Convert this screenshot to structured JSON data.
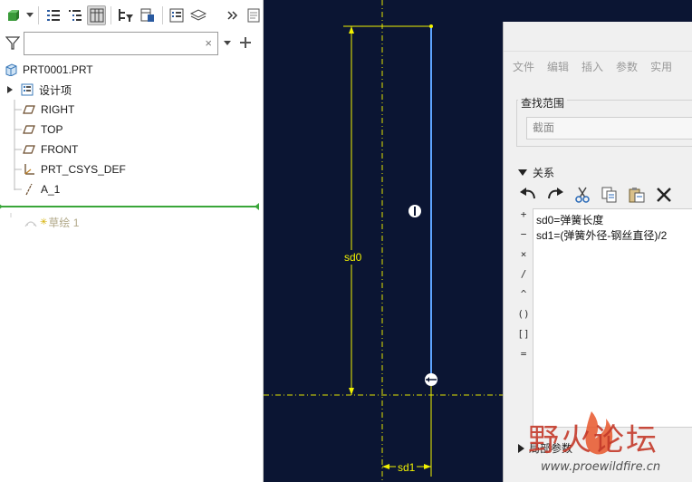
{
  "model_tree": {
    "root": "PRT0001.PRT",
    "items": [
      {
        "label": "设计项",
        "icon": "layers-icon"
      },
      {
        "label": "RIGHT",
        "icon": "datum-plane-icon"
      },
      {
        "label": "TOP",
        "icon": "datum-plane-icon"
      },
      {
        "label": "FRONT",
        "icon": "datum-plane-icon"
      },
      {
        "label": "PRT_CSYS_DEF",
        "icon": "csys-icon"
      },
      {
        "label": "A_1",
        "icon": "datum-axis-icon"
      }
    ],
    "sketch_item": "草绘 1",
    "filter_value": ""
  },
  "canvas": {
    "dim_vertical": "sd0",
    "dim_horizontal": "sd1"
  },
  "relations_dialog": {
    "menu": [
      "文件",
      "编辑",
      "插入",
      "参数",
      "实用"
    ],
    "scope_label": "查找范围",
    "scope_value": "截面",
    "relations_header": "关系",
    "operators": [
      "+",
      "−",
      "×",
      "/",
      "^",
      "()",
      "[]",
      "="
    ],
    "relations": [
      "sd0=弹簧长度",
      "sd1=(弹簧外径-钢丝直径)/2"
    ],
    "local_params": "局部参数"
  },
  "watermark": {
    "text": "野火论坛",
    "url": "www.proewildfire.cn"
  },
  "colors": {
    "canvas_bg": "#0b1533",
    "dimension": "#f2f200",
    "sketch_line": "#5ea4ff",
    "selection_line": "#3aa63a"
  }
}
